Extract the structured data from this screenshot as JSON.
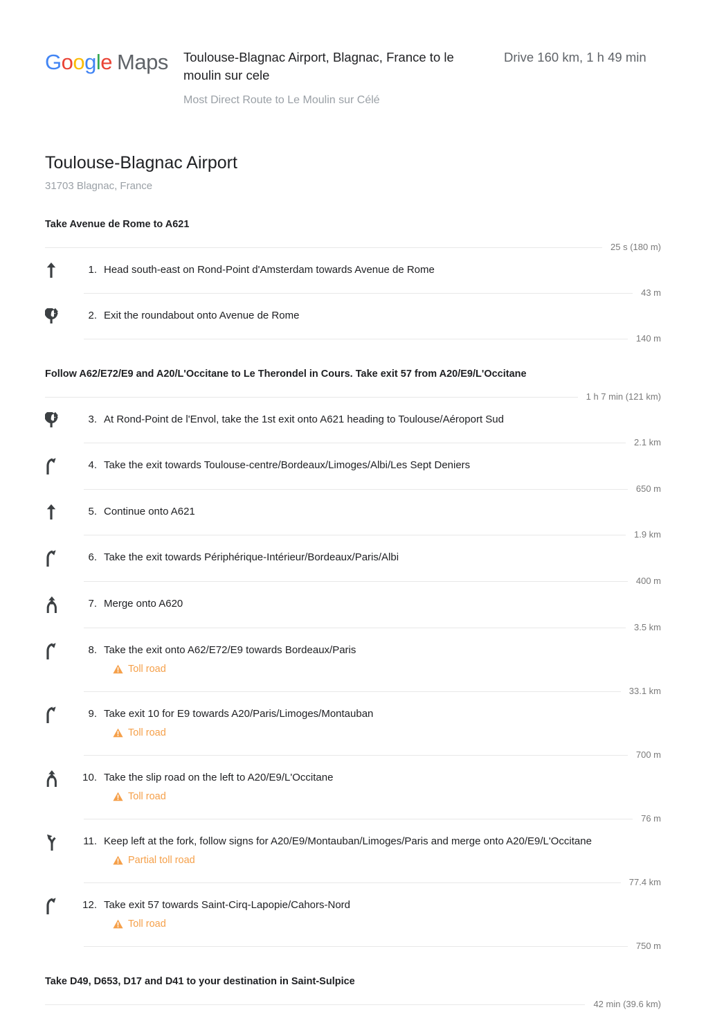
{
  "brand": {
    "google_letters": [
      "G",
      "o",
      "o",
      "g",
      "l",
      "e"
    ],
    "maps_label": "Maps",
    "colors": {
      "blue": "#4285F4",
      "red": "#EA4335",
      "yellow": "#FBBC05",
      "green": "#34A853",
      "grey": "#5F6368"
    }
  },
  "header": {
    "route_title": "Toulouse-Blagnac Airport, Blagnac, France to le moulin sur cele",
    "route_summary": "Drive 160 km, 1 h 49 min",
    "route_subtitle": "Most Direct Route to Le Moulin sur Célé"
  },
  "origin": {
    "name": "Toulouse-Blagnac Airport",
    "address": "31703 Blagnac, France"
  },
  "toll_color": "#F5A04A",
  "sections": [
    {
      "heading": "Take Avenue de Rome to A621",
      "summary": "25 s (180 m)",
      "steps": [
        {
          "num": "1.",
          "icon": "straight-arrow-icon",
          "text": "Head south-east on Rond-Point d'Amsterdam towards Avenue de Rome",
          "distance": "43 m",
          "toll": null
        },
        {
          "num": "2.",
          "icon": "roundabout-icon",
          "text": "Exit the roundabout onto Avenue de Rome",
          "distance": "140 m",
          "toll": null
        }
      ]
    },
    {
      "heading": "Follow A62/E72/E9 and A20/L'Occitane to Le Therondel in Cours. Take exit 57 from A20/E9/L'Occitane",
      "summary": "1 h 7 min (121 km)",
      "steps": [
        {
          "num": "3.",
          "icon": "roundabout-icon",
          "text": "At Rond-Point de l'Envol, take the 1st exit onto A621 heading to Toulouse/Aéroport Sud",
          "distance": "2.1 km",
          "toll": null
        },
        {
          "num": "4.",
          "icon": "ramp-right-icon",
          "text": "Take the exit towards Toulouse-centre/Bordeaux/Limoges/Albi/Les Sept Deniers",
          "distance": "650 m",
          "toll": null
        },
        {
          "num": "5.",
          "icon": "straight-arrow-icon",
          "text": "Continue onto A621",
          "distance": "1.9 km",
          "toll": null
        },
        {
          "num": "6.",
          "icon": "ramp-right-icon",
          "text": "Take the exit towards Périphérique-Intérieur/Bordeaux/Paris/Albi",
          "distance": "400 m",
          "toll": null
        },
        {
          "num": "7.",
          "icon": "merge-icon",
          "text": "Merge onto A620",
          "distance": "3.5 km",
          "toll": null
        },
        {
          "num": "8.",
          "icon": "ramp-right-icon",
          "text": "Take the exit onto A62/E72/E9 towards Bordeaux/Paris",
          "distance": "33.1 km",
          "toll": "Toll road"
        },
        {
          "num": "9.",
          "icon": "ramp-right-icon",
          "text": "Take exit 10 for E9 towards A20/Paris/Limoges/Montauban",
          "distance": "700 m",
          "toll": "Toll road"
        },
        {
          "num": "10.",
          "icon": "merge-icon",
          "text": "Take the slip road on the left to A20/E9/L'Occitane",
          "distance": "76 m",
          "toll": "Toll road"
        },
        {
          "num": "11.",
          "icon": "fork-left-icon",
          "text": "Keep left at the fork, follow signs for A20/E9/Montauban/Limoges/Paris and merge onto A20/E9/L'Occitane",
          "distance": "77.4 km",
          "toll": "Partial toll road"
        },
        {
          "num": "12.",
          "icon": "ramp-right-icon",
          "text": "Take exit 57 towards Saint-Cirq-Lapopie/Cahors-Nord",
          "distance": "750 m",
          "toll": "Toll road"
        }
      ]
    },
    {
      "heading": "Take D49, D653, D17 and D41 to your destination in Saint-Sulpice",
      "summary": "42 min (39.6 km)",
      "steps": []
    }
  ]
}
